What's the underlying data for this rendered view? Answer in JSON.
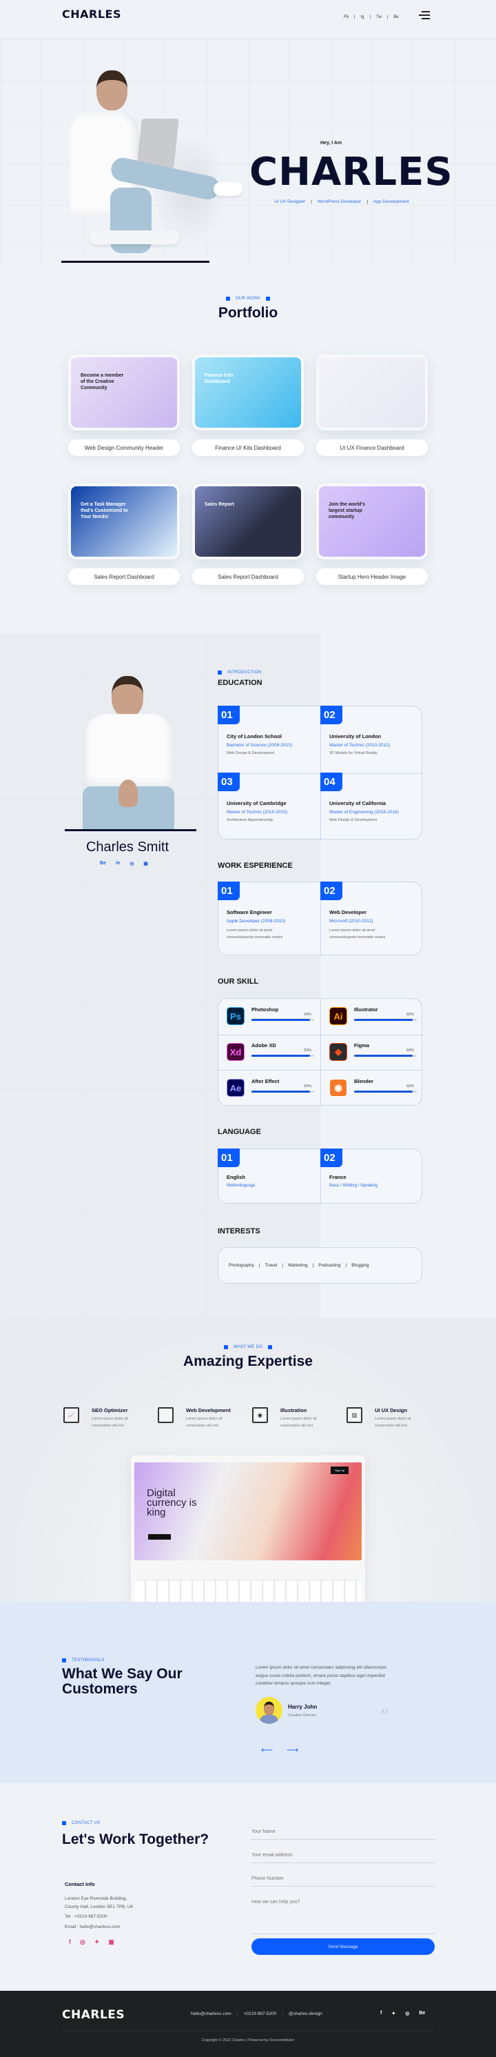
{
  "header": {
    "logo": "CHARLES",
    "social": [
      "Fb",
      "Ig",
      "Tw",
      "Be"
    ],
    "menu_icon": "hamburger-icon"
  },
  "hero": {
    "greeting": "Hey, I Am",
    "name": "CHARLES",
    "roles": [
      "UI UX Designer",
      "WordPress Developer",
      "App Development"
    ]
  },
  "portfolio": {
    "tag": "OUR WORK",
    "title": "Portfolio",
    "items": [
      {
        "caption": "Web Design Community Header",
        "thumb_title": "Become a member of the Creative Community"
      },
      {
        "caption": "Finance UI Kits Dashboard",
        "thumb_title": "Finance Kits Dashboard"
      },
      {
        "caption": "UI UX Finance Dashboard",
        "thumb_title": ""
      },
      {
        "caption": "Sales Report Dashboard",
        "thumb_title": "Get a Task Manager that's Customized to Your Needs!"
      },
      {
        "caption": "Sales Report Dashboard",
        "thumb_title": "Sales Report"
      },
      {
        "caption": "Startup Hero Header Image",
        "thumb_title": "Join the world's largest startup community"
      }
    ]
  },
  "about": {
    "name": "Charles Smitt",
    "social": [
      "Be",
      "in",
      "dribbble",
      "instagram"
    ],
    "tag": "INTRODUCTION",
    "education": {
      "title": "EDUCATION",
      "items": [
        {
          "num": "01",
          "school": "City of London School",
          "degree": "Bachelor of Science (2008-2010)",
          "desc": "Web Design & Development"
        },
        {
          "num": "02",
          "school": "University of London",
          "degree": "Master of Technic (2010-2012)",
          "desc": "3D Models for Virtual Reality"
        },
        {
          "num": "03",
          "school": "University of Cambridge",
          "degree": "Master of Technic (2010-2015)",
          "desc": "Architecture Apprenticeship"
        },
        {
          "num": "04",
          "school": "University of California",
          "degree": "Master of Engineering (2016-2018)",
          "desc": "Web Design & Development"
        }
      ]
    },
    "work": {
      "title": "WORK ESPERIENCE",
      "items": [
        {
          "num": "01",
          "role": "Software Engineer",
          "company": "Apple Developer (2008-2010)",
          "desc": "Lorem ipsum dolor sit amet consectetuporta venenatis nostra"
        },
        {
          "num": "02",
          "role": "Web Developer",
          "company": "Microsoft (2010-2012)",
          "desc": "Lorem ipsum dolor sit amet consectetuporta venenatis nostra"
        }
      ]
    },
    "skills": {
      "title": "OUR SKILL",
      "items": [
        {
          "name": "Photoshop",
          "icon": "Ps",
          "percent": 93,
          "label": "93%",
          "bg": "#001e36",
          "fg": "#31a8ff"
        },
        {
          "name": "Illustrator",
          "icon": "Ai",
          "percent": 93,
          "label": "93%",
          "bg": "#330000",
          "fg": "#ff9a00"
        },
        {
          "name": "Adobe XD",
          "icon": "Xd",
          "percent": 93,
          "label": "93%",
          "bg": "#470137",
          "fg": "#ff61f6"
        },
        {
          "name": "Figma",
          "icon": "figma",
          "percent": 93,
          "label": "93%",
          "bg": "#2c2c2c",
          "fg": "#f24e1e"
        },
        {
          "name": "After Effect",
          "icon": "Ae",
          "percent": 93,
          "label": "93%",
          "bg": "#00005b",
          "fg": "#9999ff"
        },
        {
          "name": "Blender",
          "icon": "blender",
          "percent": 93,
          "label": "93%",
          "bg": "#f5792a",
          "fg": "#ffffff"
        }
      ]
    },
    "language": {
      "title": "LANGUAGE",
      "items": [
        {
          "num": "01",
          "name": "English",
          "level": "Motherlinguage"
        },
        {
          "num": "02",
          "name": "France",
          "level": "Basic / Writting / Speaking"
        }
      ]
    },
    "interests": {
      "title": "INTERESTS",
      "items": [
        "Photography",
        "Travel",
        "Marketing",
        "Podcasting",
        "Blogging"
      ]
    }
  },
  "expertise": {
    "tag": "WHAT WE DO",
    "title": "Amazing Expertise",
    "items": [
      {
        "title": "SEO Optimizer",
        "desc": "Lorem ipsum dolor sit consectetur elit orci"
      },
      {
        "title": "Web Development",
        "desc": "Lorem ipsum dolor sit consectetur elit orci"
      },
      {
        "title": "Illustration",
        "desc": "Lorem ipsum dolor sit consectetur elit orci"
      },
      {
        "title": "UI UX Design",
        "desc": "Lorem ipsum dolor sit consectetur elit orci"
      }
    ],
    "laptop": {
      "headline": "Digital currency is king",
      "signup": "Sign Up"
    }
  },
  "testimonials": {
    "tag": "TESTIMONIALS",
    "title": "What We Say Our Customers",
    "quote": "Lorem ipsum dolor sit amet consectatur adipiscing elit ullamcorper augue curae cubilia pretium, ornare purus dapibus eget imperdiet curabitur tempus quisque cum integer",
    "author": "Harry John",
    "role": "Creative Director"
  },
  "contact": {
    "tag": "CONTACT US",
    "title": "Let's Work Together?",
    "info_title": "Contact Info",
    "address1": "London Eye Riverside Building,",
    "address2": "County Hall, London SE1 7PB, UK",
    "tel": "Tel : +0219-987-5200",
    "email": "Email : hello@charless.com",
    "form": {
      "name_ph": "Your Name",
      "email_ph": "Your email address",
      "phone_ph": "Phone Number",
      "message_ph": "How we can help you?",
      "submit": "Send Message"
    }
  },
  "footer": {
    "logo": "CHARLES",
    "links": [
      "hello@charless.com",
      "+0219-987-5200",
      "@charles-design"
    ],
    "social": [
      "f",
      "tw",
      "dribbble",
      "Be"
    ],
    "copyright": "Copyright © 2022 Charles | Powered by Onecontributor"
  },
  "colors": {
    "accent": "#0b5cff",
    "navy": "#0b0f2e",
    "footer": "#1f2022",
    "testimonial_bg": "#dfe8f7"
  }
}
